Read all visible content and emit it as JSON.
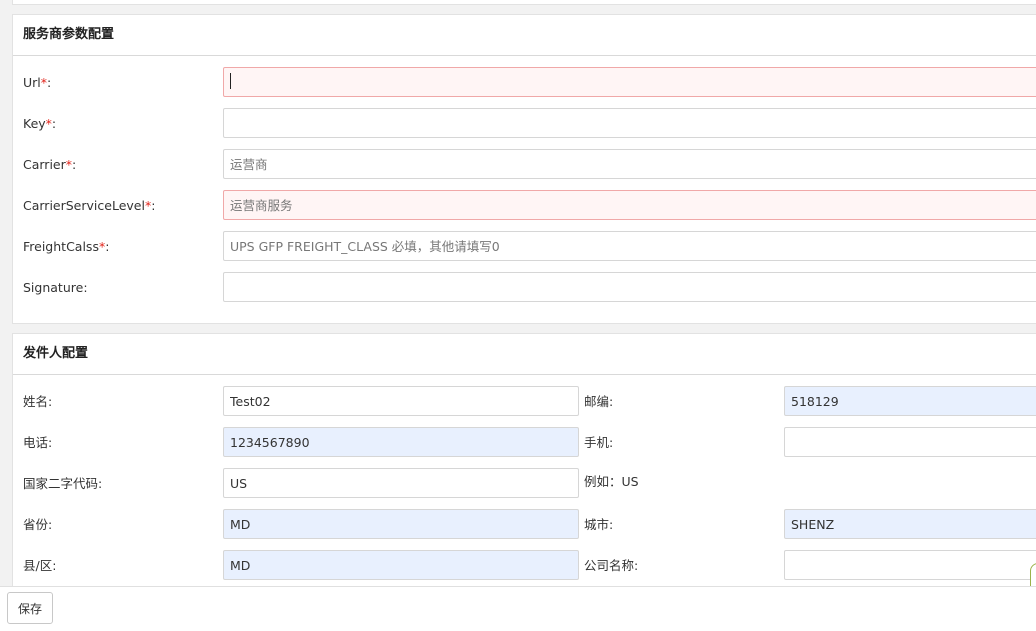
{
  "service_panel": {
    "title": "服务商参数配置",
    "fields": [
      {
        "label": "Url",
        "required": "*",
        "colon": ":",
        "value": "",
        "placeholder": ""
      },
      {
        "label": "Key",
        "required": "*",
        "colon": ":",
        "value": "",
        "placeholder": ""
      },
      {
        "label": "Carrier",
        "required": "*",
        "colon": ":",
        "value": "",
        "placeholder": "运营商"
      },
      {
        "label": "CarrierServiceLevel",
        "required": "*",
        "colon": ":",
        "value": "",
        "placeholder": "运营商服务"
      },
      {
        "label": "FreightCalss",
        "required": "*",
        "colon": ":",
        "value": "",
        "placeholder": "UPS GFP FREIGHT_CLASS 必填，其他请填写0"
      },
      {
        "label": "Signature",
        "colon": ":",
        "value": "",
        "placeholder": ""
      }
    ]
  },
  "sender_panel": {
    "title": "发件人配置",
    "fields": {
      "name": {
        "label": "姓名:",
        "value": "Test02"
      },
      "zip": {
        "label": "邮编:",
        "value": "518129"
      },
      "phone": {
        "label": "电话:",
        "value": "1234567890"
      },
      "mobile": {
        "label": "手机:",
        "value": ""
      },
      "country": {
        "label": "国家二字代码:",
        "value": "US",
        "hint": "例如：US"
      },
      "province": {
        "label": "省份:",
        "value": "MD"
      },
      "city": {
        "label": "城市:",
        "value": "SHENZ"
      },
      "county": {
        "label": "县/区:",
        "value": "MD"
      },
      "company": {
        "label": "公司名称:",
        "value": ""
      }
    }
  },
  "footer": {
    "save_label": "保存"
  },
  "colors": {
    "required_mark": "#e2231a",
    "autofill_bg": "#e8f0fe",
    "error_border": "#f0a8a8"
  }
}
